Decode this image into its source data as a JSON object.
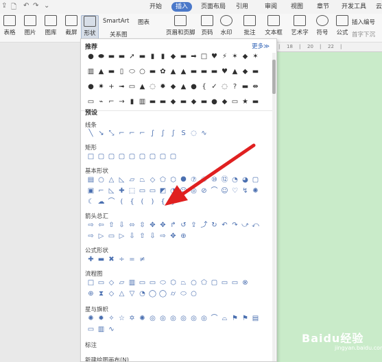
{
  "quick_access": [
    "⇪",
    "🗋",
    "↶",
    "↷",
    "⌄"
  ],
  "tabs": [
    {
      "label": "开始",
      "active": false
    },
    {
      "label": "插入",
      "active": true
    },
    {
      "label": "页面布局",
      "active": false
    },
    {
      "label": "引用",
      "active": false
    },
    {
      "label": "审阅",
      "active": false
    },
    {
      "label": "视图",
      "active": false
    },
    {
      "label": "章节",
      "active": false
    },
    {
      "label": "开发工具",
      "active": false
    },
    {
      "label": "云",
      "active": false
    }
  ],
  "ribbon": {
    "table": "表格",
    "picture": "图片",
    "gallery": "图库",
    "screenshot": "截屏",
    "shapes": "形状",
    "smartart": "SmartArt",
    "chart": "图表",
    "relation": "关系图",
    "header_footer": "页眉和页脚",
    "page_number": "页码",
    "watermark": "水印",
    "comment": "批注",
    "textbox": "文本框",
    "wordart": "艺术字",
    "symbol": "符号",
    "formula": "公式",
    "insert_number": "插入编号",
    "first_drop": "首字下沉"
  },
  "panel": {
    "recommended": "推荐",
    "more": "更多≫",
    "preset": "预设",
    "sections": {
      "lines": "线条",
      "rect": "矩形",
      "basic": "基本形状",
      "arrows": "箭头总汇",
      "formula": "公式形状",
      "flow": "流程图",
      "stars": "星与旗帜",
      "callout": "标注"
    },
    "bottom": "新建绘图画布(N)"
  },
  "ruler_ticks": [
    "|",
    "18",
    "|",
    "20",
    "|",
    "22",
    "|"
  ],
  "watermark": {
    "text": "Baidu经验",
    "sub": "jingyan.baidu.com"
  },
  "colors": {
    "accent": "#4a78c9",
    "doc": "#c9ebc9",
    "arrow": "#e02020"
  }
}
